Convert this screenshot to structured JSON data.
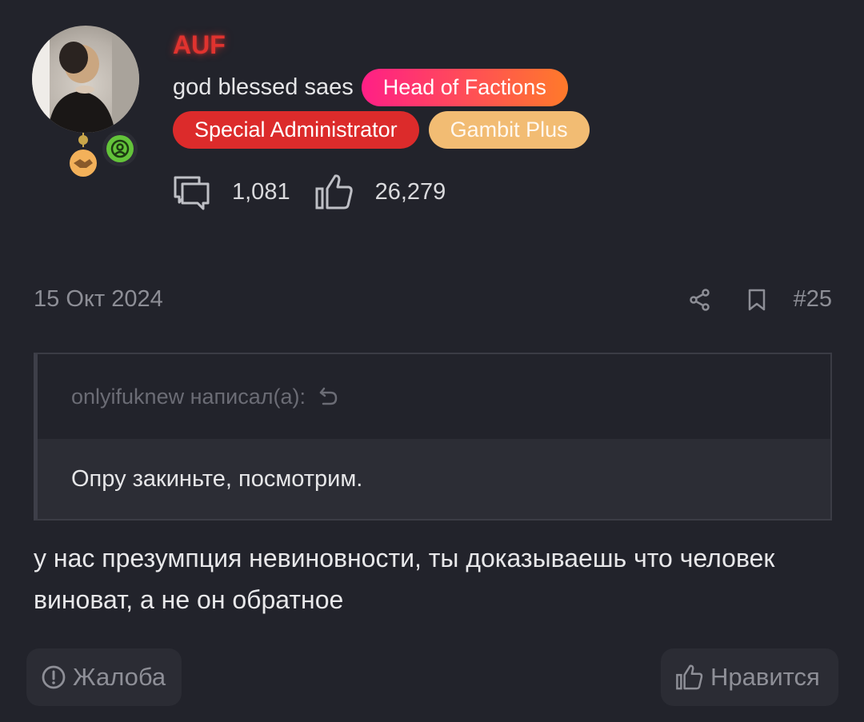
{
  "user": {
    "name": "AUF",
    "title": "god blessed saes",
    "badges": [
      {
        "label": "Head of Factions"
      },
      {
        "label": "Special Administrator"
      },
      {
        "label": "Gambit Plus"
      }
    ],
    "stats": {
      "messages": "1,081",
      "likes": "26,279"
    }
  },
  "post": {
    "date": "15 Окт 2024",
    "number": "#25",
    "quote": {
      "author_line": "onlyifuknew написал(а):",
      "text": "Опру закиньте, посмотрим."
    },
    "body": "у нас презумпция невиновности, ты доказываешь что человек виноват, а не он обратное"
  },
  "buttons": {
    "report": "Жалоба",
    "like": "Нравится"
  },
  "colors": {
    "background": "#22232b",
    "username": "#e0332f",
    "faction_badge": "#ff3c6a",
    "admin_badge": "#dc2b2b",
    "gambit_badge": "#f2bc73",
    "online": "#63c33a"
  }
}
